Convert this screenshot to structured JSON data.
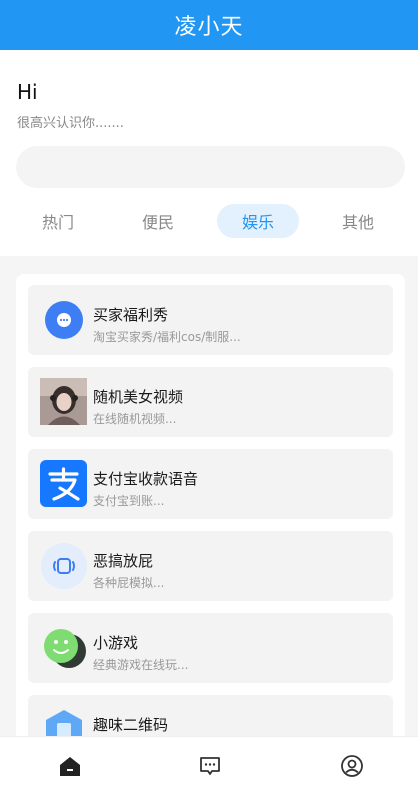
{
  "header": {
    "title": "凌小天"
  },
  "greeting": {
    "hi": "Hi",
    "subtitle": "很高兴认识你......."
  },
  "search": {
    "placeholder": ""
  },
  "tabs": [
    {
      "label": "热门",
      "active": false
    },
    {
      "label": "便民",
      "active": false
    },
    {
      "label": "娱乐",
      "active": true
    },
    {
      "label": "其他",
      "active": false
    }
  ],
  "items": [
    {
      "name": "买家福利秀",
      "desc": "淘宝买家秀/福利cos/制服...",
      "icon": "chat-bubble-icon"
    },
    {
      "name": "随机美女视频",
      "desc": "在线随机视频...",
      "icon": "portrait-thumbnail"
    },
    {
      "name": "支付宝收款语音",
      "desc": "支付宝到账...",
      "icon": "alipay-icon"
    },
    {
      "name": "恶搞放屁",
      "desc": "各种屁模拟...",
      "icon": "sound-icon"
    },
    {
      "name": "小游戏",
      "desc": "经典游戏在线玩...",
      "icon": "game-face-icon"
    },
    {
      "name": "趣味二维码",
      "desc": "",
      "icon": "qrcode-hexagon-icon"
    }
  ],
  "colors": {
    "primary": "#2196f3",
    "activeTabBg": "#e3f0fd",
    "alipay": "#1677ff"
  },
  "bottom_nav": [
    "home-icon",
    "message-icon",
    "profile-icon"
  ]
}
